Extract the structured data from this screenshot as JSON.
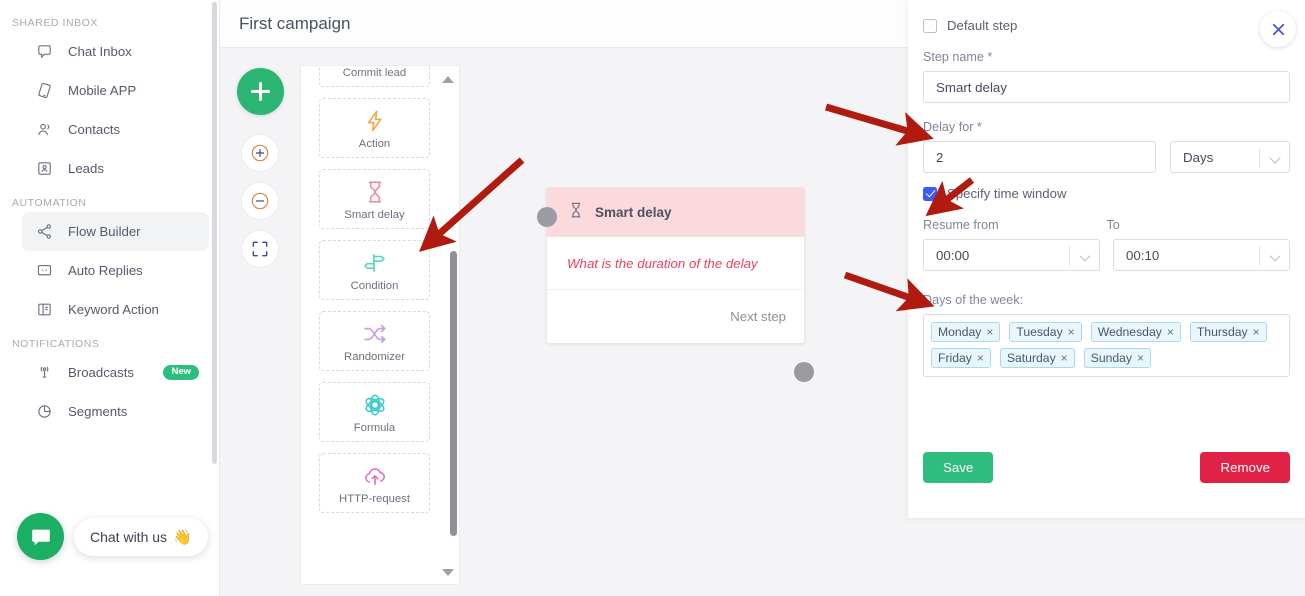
{
  "sidebar": {
    "sections": [
      {
        "title": "SHARED INBOX",
        "items": [
          {
            "label": "Chat Inbox",
            "icon": "chat-icon",
            "active": false,
            "badge": null
          },
          {
            "label": "Mobile APP",
            "icon": "mobile-app-icon",
            "active": false,
            "badge": null
          },
          {
            "label": "Contacts",
            "icon": "contacts-icon",
            "active": false,
            "badge": null
          },
          {
            "label": "Leads",
            "icon": "leads-icon",
            "active": false,
            "badge": null
          }
        ]
      },
      {
        "title": "AUTOMATION",
        "items": [
          {
            "label": "Flow Builder",
            "icon": "flow-builder-icon",
            "active": true,
            "badge": null
          },
          {
            "label": "Auto Replies",
            "icon": "auto-replies-icon",
            "active": false,
            "badge": null
          },
          {
            "label": "Keyword Action",
            "icon": "keyword-action-icon",
            "active": false,
            "badge": null
          }
        ]
      },
      {
        "title": "NOTIFICATIONS",
        "items": [
          {
            "label": "Broadcasts",
            "icon": "broadcasts-icon",
            "active": false,
            "badge": "New"
          },
          {
            "label": "Segments",
            "icon": "segments-icon",
            "active": false,
            "badge": null
          }
        ]
      }
    ],
    "chat_widget": {
      "label": "Chat with us",
      "emoji": "👋",
      "icon": "chat-bubble-icon"
    }
  },
  "header": {
    "title": "First campaign"
  },
  "canvas": {
    "add_button_icon": "plus-icon",
    "controls": [
      {
        "name": "zoom-in",
        "icon": "zoom-in-icon"
      },
      {
        "name": "zoom-out",
        "icon": "zoom-out-icon"
      },
      {
        "name": "fit-screen",
        "icon": "fit-screen-icon"
      }
    ],
    "palette": {
      "items": [
        {
          "label": "Commit lead",
          "icon": "check-circle-icon",
          "color": "#7ec8f0"
        },
        {
          "label": "Action",
          "icon": "lightning-icon",
          "color": "#f5a64a"
        },
        {
          "label": "Smart delay",
          "icon": "hourglass-icon",
          "color": "#f08a96"
        },
        {
          "label": "Condition",
          "icon": "signpost-icon",
          "color": "#5fd3c4"
        },
        {
          "label": "Randomizer",
          "icon": "shuffle-icon",
          "color": "#c79de0"
        },
        {
          "label": "Formula",
          "icon": "atom-icon",
          "color": "#3dc9cf"
        },
        {
          "label": "HTTP-request",
          "icon": "cloud-upload-icon",
          "color": "#e070d0"
        }
      ]
    },
    "node": {
      "title": "Smart delay",
      "icon": "hourglass-icon",
      "question": "What is the duration of the delay",
      "next_step_label": "Next step",
      "header_color": "#fbd9dd",
      "question_color": "#e8415f"
    }
  },
  "panel": {
    "close_icon": "close-icon",
    "default_step": {
      "label": "Default step",
      "checked": false
    },
    "step_name": {
      "label": "Step name *",
      "value": "Smart delay"
    },
    "delay_for": {
      "label": "Delay for *",
      "amount": "2",
      "unit": "Days"
    },
    "specify_time_window": {
      "label": "Specify time window",
      "checked": true
    },
    "resume_from": {
      "label": "Resume from",
      "value": "00:00"
    },
    "to": {
      "label": "To",
      "value": "00:10"
    },
    "days_of_week": {
      "label": "Days of the week:",
      "tags": [
        "Monday",
        "Tuesday",
        "Wednesday",
        "Thursday",
        "Friday",
        "Saturday",
        "Sunday"
      ],
      "remove_glyph": "×"
    },
    "save_label": "Save",
    "remove_label": "Remove"
  },
  "colors": {
    "accent_green": "#2ebd7e",
    "danger_red": "#e02246",
    "annotation_red": "#b01b10",
    "checkbox_blue": "#3d5afe",
    "close_blue": "#4a4ddb"
  }
}
